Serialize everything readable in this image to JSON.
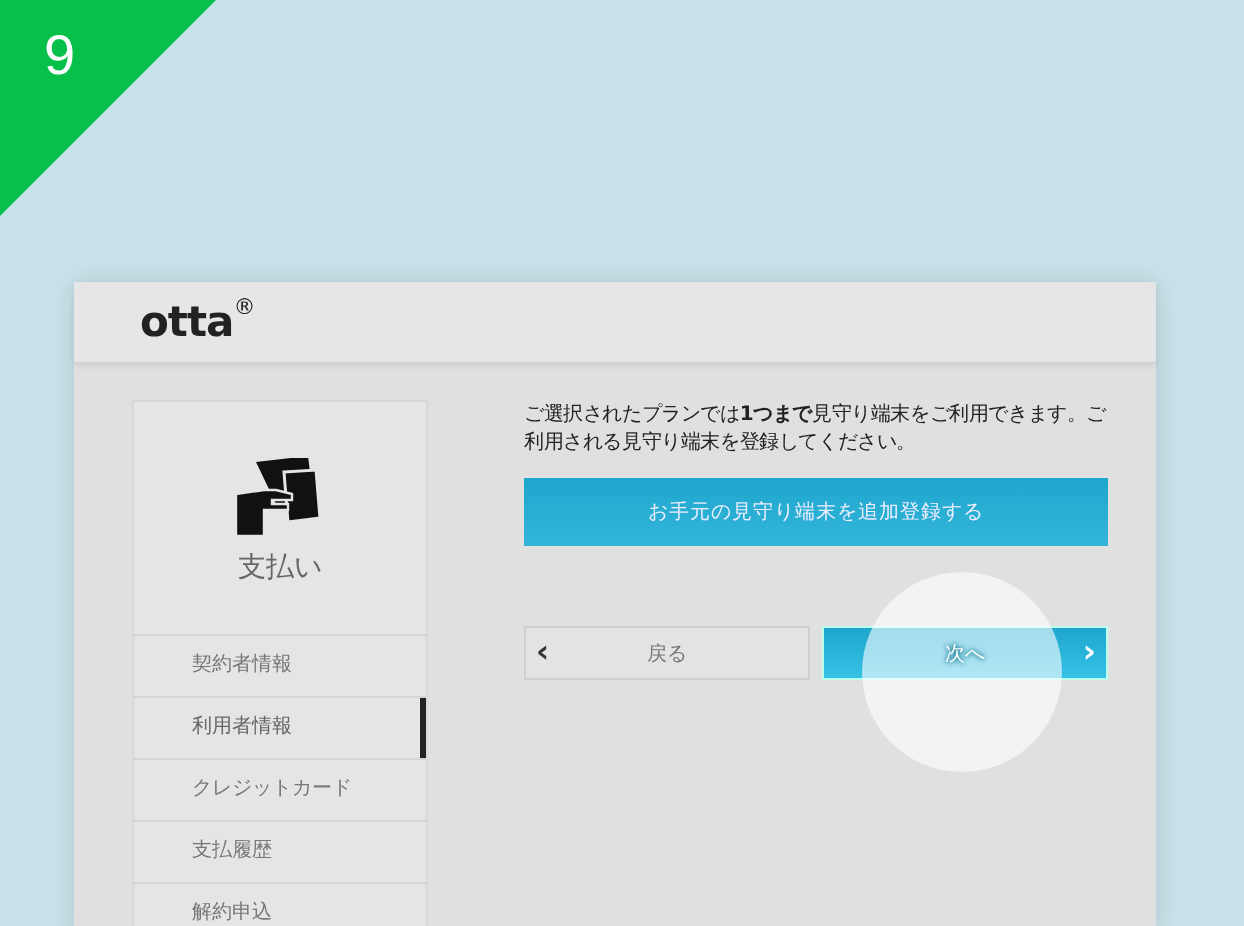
{
  "step_badge": "9",
  "header": {
    "logo": "otta",
    "logo_mark": "®"
  },
  "sidebar": {
    "title": "支払い",
    "items": [
      {
        "label": "契約者情報",
        "selected": false
      },
      {
        "label": "利用者情報",
        "selected": true
      },
      {
        "label": "クレジットカード",
        "selected": false
      },
      {
        "label": "支払履歴",
        "selected": false
      },
      {
        "label": "解約申込",
        "selected": false
      }
    ]
  },
  "content": {
    "message": "ご選択されたプランでは**1つまで**見守り端末をご利用できます。ご利用される見守り端末を登録してください。",
    "add_button": "お手元の見守り端末を追加登録する",
    "back_button": {
      "label": "戻る",
      "arrow": "‹"
    },
    "next_button": {
      "label": "次へ",
      "arrow": "›",
      "tapped": true
    }
  }
}
